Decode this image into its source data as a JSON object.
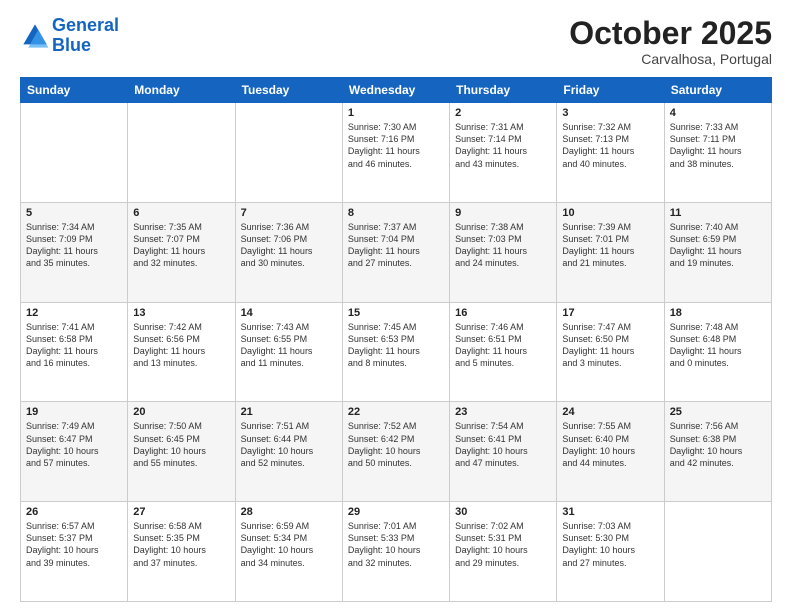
{
  "logo": {
    "line1": "General",
    "line2": "Blue"
  },
  "title": "October 2025",
  "subtitle": "Carvalhosa, Portugal",
  "days_of_week": [
    "Sunday",
    "Monday",
    "Tuesday",
    "Wednesday",
    "Thursday",
    "Friday",
    "Saturday"
  ],
  "weeks": [
    [
      {
        "day": "",
        "info": ""
      },
      {
        "day": "",
        "info": ""
      },
      {
        "day": "",
        "info": ""
      },
      {
        "day": "1",
        "info": "Sunrise: 7:30 AM\nSunset: 7:16 PM\nDaylight: 11 hours\nand 46 minutes."
      },
      {
        "day": "2",
        "info": "Sunrise: 7:31 AM\nSunset: 7:14 PM\nDaylight: 11 hours\nand 43 minutes."
      },
      {
        "day": "3",
        "info": "Sunrise: 7:32 AM\nSunset: 7:13 PM\nDaylight: 11 hours\nand 40 minutes."
      },
      {
        "day": "4",
        "info": "Sunrise: 7:33 AM\nSunset: 7:11 PM\nDaylight: 11 hours\nand 38 minutes."
      }
    ],
    [
      {
        "day": "5",
        "info": "Sunrise: 7:34 AM\nSunset: 7:09 PM\nDaylight: 11 hours\nand 35 minutes."
      },
      {
        "day": "6",
        "info": "Sunrise: 7:35 AM\nSunset: 7:07 PM\nDaylight: 11 hours\nand 32 minutes."
      },
      {
        "day": "7",
        "info": "Sunrise: 7:36 AM\nSunset: 7:06 PM\nDaylight: 11 hours\nand 30 minutes."
      },
      {
        "day": "8",
        "info": "Sunrise: 7:37 AM\nSunset: 7:04 PM\nDaylight: 11 hours\nand 27 minutes."
      },
      {
        "day": "9",
        "info": "Sunrise: 7:38 AM\nSunset: 7:03 PM\nDaylight: 11 hours\nand 24 minutes."
      },
      {
        "day": "10",
        "info": "Sunrise: 7:39 AM\nSunset: 7:01 PM\nDaylight: 11 hours\nand 21 minutes."
      },
      {
        "day": "11",
        "info": "Sunrise: 7:40 AM\nSunset: 6:59 PM\nDaylight: 11 hours\nand 19 minutes."
      }
    ],
    [
      {
        "day": "12",
        "info": "Sunrise: 7:41 AM\nSunset: 6:58 PM\nDaylight: 11 hours\nand 16 minutes."
      },
      {
        "day": "13",
        "info": "Sunrise: 7:42 AM\nSunset: 6:56 PM\nDaylight: 11 hours\nand 13 minutes."
      },
      {
        "day": "14",
        "info": "Sunrise: 7:43 AM\nSunset: 6:55 PM\nDaylight: 11 hours\nand 11 minutes."
      },
      {
        "day": "15",
        "info": "Sunrise: 7:45 AM\nSunset: 6:53 PM\nDaylight: 11 hours\nand 8 minutes."
      },
      {
        "day": "16",
        "info": "Sunrise: 7:46 AM\nSunset: 6:51 PM\nDaylight: 11 hours\nand 5 minutes."
      },
      {
        "day": "17",
        "info": "Sunrise: 7:47 AM\nSunset: 6:50 PM\nDaylight: 11 hours\nand 3 minutes."
      },
      {
        "day": "18",
        "info": "Sunrise: 7:48 AM\nSunset: 6:48 PM\nDaylight: 11 hours\nand 0 minutes."
      }
    ],
    [
      {
        "day": "19",
        "info": "Sunrise: 7:49 AM\nSunset: 6:47 PM\nDaylight: 10 hours\nand 57 minutes."
      },
      {
        "day": "20",
        "info": "Sunrise: 7:50 AM\nSunset: 6:45 PM\nDaylight: 10 hours\nand 55 minutes."
      },
      {
        "day": "21",
        "info": "Sunrise: 7:51 AM\nSunset: 6:44 PM\nDaylight: 10 hours\nand 52 minutes."
      },
      {
        "day": "22",
        "info": "Sunrise: 7:52 AM\nSunset: 6:42 PM\nDaylight: 10 hours\nand 50 minutes."
      },
      {
        "day": "23",
        "info": "Sunrise: 7:54 AM\nSunset: 6:41 PM\nDaylight: 10 hours\nand 47 minutes."
      },
      {
        "day": "24",
        "info": "Sunrise: 7:55 AM\nSunset: 6:40 PM\nDaylight: 10 hours\nand 44 minutes."
      },
      {
        "day": "25",
        "info": "Sunrise: 7:56 AM\nSunset: 6:38 PM\nDaylight: 10 hours\nand 42 minutes."
      }
    ],
    [
      {
        "day": "26",
        "info": "Sunrise: 6:57 AM\nSunset: 5:37 PM\nDaylight: 10 hours\nand 39 minutes."
      },
      {
        "day": "27",
        "info": "Sunrise: 6:58 AM\nSunset: 5:35 PM\nDaylight: 10 hours\nand 37 minutes."
      },
      {
        "day": "28",
        "info": "Sunrise: 6:59 AM\nSunset: 5:34 PM\nDaylight: 10 hours\nand 34 minutes."
      },
      {
        "day": "29",
        "info": "Sunrise: 7:01 AM\nSunset: 5:33 PM\nDaylight: 10 hours\nand 32 minutes."
      },
      {
        "day": "30",
        "info": "Sunrise: 7:02 AM\nSunset: 5:31 PM\nDaylight: 10 hours\nand 29 minutes."
      },
      {
        "day": "31",
        "info": "Sunrise: 7:03 AM\nSunset: 5:30 PM\nDaylight: 10 hours\nand 27 minutes."
      },
      {
        "day": "",
        "info": ""
      }
    ]
  ]
}
